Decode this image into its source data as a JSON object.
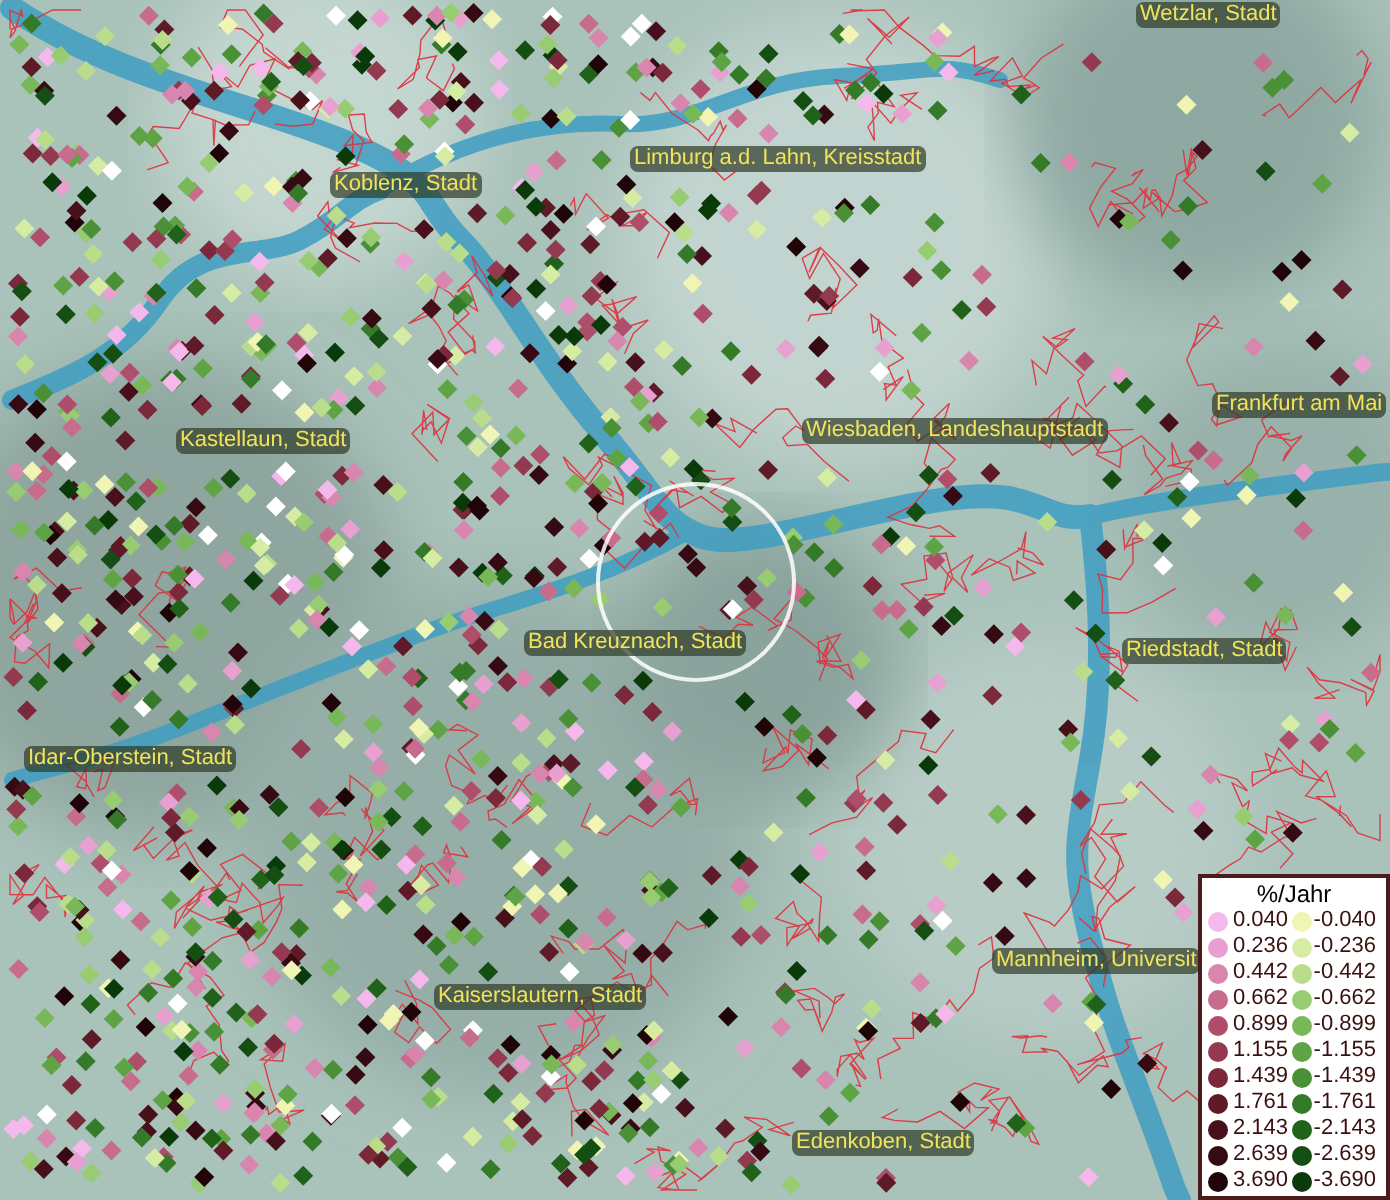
{
  "map": {
    "place_labels": [
      "Wetzlar, Stadt",
      "Limburg a.d. Lahn, Kreisstadt",
      "Koblenz, Stadt",
      "Kastellaun, Stadt",
      "Wiesbaden, Landeshauptstadt",
      "Frankfurt am Mai",
      "Bad Kreuznach, Stadt",
      "Riedstadt, Stadt",
      "Idar-Oberstein, Stadt",
      "Mannheim, Universit",
      "Kaiserslautern, Stadt",
      "Edenkoben, Stadt"
    ]
  },
  "legend": {
    "title": "%/Jahr",
    "rows": [
      {
        "positive": {
          "value": "0.040",
          "color": "#f5b8ec"
        },
        "negative": {
          "value": "-0.040",
          "color": "#f0f5b4"
        }
      },
      {
        "positive": {
          "value": "0.236",
          "color": "#e8a0d0"
        },
        "negative": {
          "value": "-0.236",
          "color": "#d6eca2"
        }
      },
      {
        "positive": {
          "value": "0.442",
          "color": "#d886ae"
        },
        "negative": {
          "value": "-0.442",
          "color": "#badd8c"
        }
      },
      {
        "positive": {
          "value": "0.662",
          "color": "#c76c8c"
        },
        "negative": {
          "value": "-0.662",
          "color": "#98cc72"
        }
      },
      {
        "positive": {
          "value": "0.899",
          "color": "#ae4e6a"
        },
        "negative": {
          "value": "-0.899",
          "color": "#78b858"
        }
      },
      {
        "positive": {
          "value": "1.155",
          "color": "#933a50"
        },
        "negative": {
          "value": "-1.155",
          "color": "#5ea444"
        }
      },
      {
        "positive": {
          "value": "1.439",
          "color": "#7a283a"
        },
        "negative": {
          "value": "-1.439",
          "color": "#4a9036"
        }
      },
      {
        "positive": {
          "value": "1.761",
          "color": "#5e1a26"
        },
        "negative": {
          "value": "-1.761",
          "color": "#357a28"
        }
      },
      {
        "positive": {
          "value": "2.143",
          "color": "#48101a"
        },
        "negative": {
          "value": "-2.143",
          "color": "#21621a"
        }
      },
      {
        "positive": {
          "value": "2.639",
          "color": "#360a12"
        },
        "negative": {
          "value": "-2.639",
          "color": "#154e12"
        }
      },
      {
        "positive": {
          "value": "3.690",
          "color": "#200508"
        },
        "negative": {
          "value": "-3.690",
          "color": "#0b3a0a"
        }
      }
    ]
  }
}
